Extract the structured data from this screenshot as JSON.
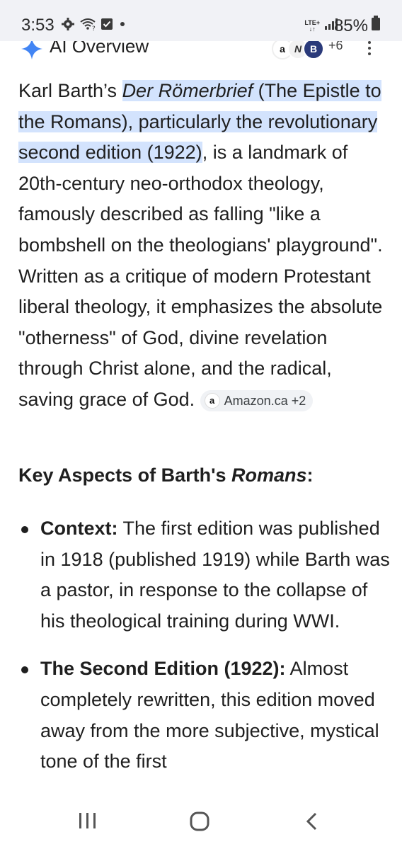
{
  "status_bar": {
    "time": "3:53",
    "network": "LTE+",
    "battery": "85%",
    "icons": [
      "gear-icon",
      "wifi-question-icon",
      "checkbox-icon",
      "dot-icon",
      "signal-icon",
      "battery-icon"
    ]
  },
  "ai_overview": {
    "title": "AI Overview",
    "sources_more": "+6"
  },
  "content": {
    "intro_prefix": "Karl Barth’s ",
    "intro_title": "Der Römerbrief",
    "intro_highlight_rest": " (The Epistle to the Romans), particularly the revolutionary second edition (1922)",
    "intro_body": ", is a landmark of 20th-century neo-orthodox theology, famously described as falling \"like a bombshell on the theologians' playground\". Written as a critique of modern Protestant liberal theology, it emphasizes the absolute \"otherness\" of God, divine revelation through Christ alone, and the radical, saving grace of God. ",
    "citation": {
      "logo": "a",
      "label": "Amazon.ca +2"
    },
    "section_heading_prefix": "Key Aspects of Barth's ",
    "section_heading_italic": "Romans",
    "section_heading_suffix": ":",
    "bullets": [
      {
        "title": "Context:",
        "text": " The first edition was published in 1918 (published 1919) while Barth was a pastor, in response to the collapse of his theological training during WWI."
      },
      {
        "title": "The Second Edition (1922):",
        "text": " Almost completely rewritten, this edition moved away from the more subjective, mystical tone of the first"
      }
    ]
  },
  "nav_bar": {
    "buttons": [
      "recents-button",
      "home-button",
      "back-button"
    ]
  }
}
